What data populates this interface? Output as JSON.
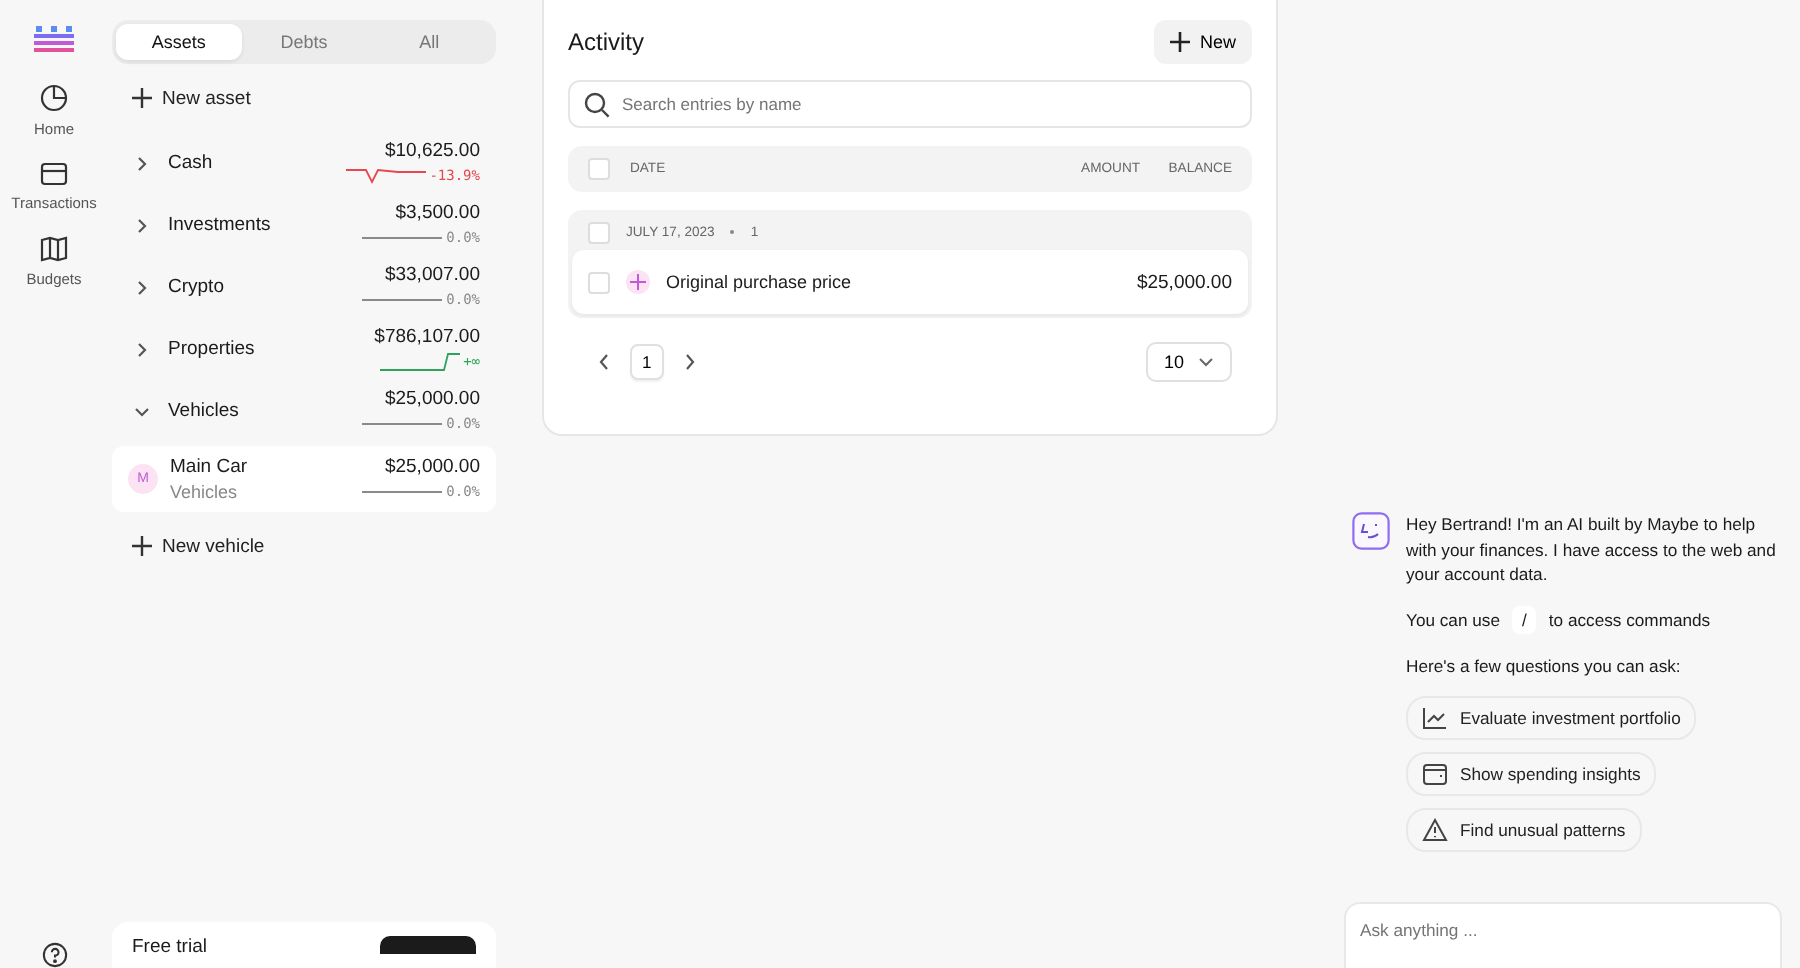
{
  "nav": [
    {
      "label": "Home"
    },
    {
      "label": "Transactions"
    },
    {
      "label": "Budgets"
    }
  ],
  "account_tabs": [
    {
      "label": "Assets",
      "selected": true
    },
    {
      "label": "Debts",
      "selected": false
    },
    {
      "label": "All",
      "selected": false
    }
  ],
  "new_asset": "New asset",
  "groups": [
    {
      "name": "Cash",
      "expanded": false,
      "balance": "$10,625.00",
      "change": "-13.9%",
      "kind": "down"
    },
    {
      "name": "Investments",
      "expanded": false,
      "balance": "$3,500.00",
      "change": "0.0%",
      "kind": "flat"
    },
    {
      "name": "Crypto",
      "expanded": false,
      "balance": "$33,007.00",
      "change": "0.0%",
      "kind": "flat"
    },
    {
      "name": "Properties",
      "expanded": false,
      "balance": "$786,107.00",
      "change": "+∞",
      "kind": "up"
    },
    {
      "name": "Vehicles",
      "expanded": true,
      "balance": "$25,000.00",
      "change": "0.0%",
      "kind": "flat",
      "accounts": [
        {
          "initial": "M",
          "name": "Main Car",
          "subtitle": "Vehicles",
          "balance": "$25,000.00",
          "change": "0.0%",
          "kind": "flat",
          "selected": true
        }
      ]
    }
  ],
  "new_vehicle": "New vehicle",
  "free_trial": {
    "title": "Free trial"
  },
  "activity": {
    "title": "Activity",
    "new_button": "New",
    "search": {
      "placeholder": "Search entries by name"
    },
    "columns": [
      "DATE",
      "AMOUNT",
      "BALANCE"
    ],
    "select_all_checked": false,
    "date_groups": [
      {
        "date": "JULY 17, 2023",
        "count": "1",
        "checked": false,
        "entries": [
          {
            "name": "Original purchase price",
            "amount": "$25,000.00",
            "checked": false
          }
        ]
      }
    ],
    "pages": [
      {
        "label": "1",
        "selected": true
      }
    ],
    "per_page": "10"
  },
  "chat": {
    "intro": "Hey Bertrand! I'm an AI built by Maybe to help with your finances. I have access to the web and your account data.",
    "commands_before": "You can use",
    "command_key": "/",
    "commands_after": "to access commands",
    "questions_heading": "Here's a few questions you can ask:",
    "suggestions": [
      {
        "label": "Evaluate investment portfolio"
      },
      {
        "label": "Show spending insights"
      },
      {
        "label": "Find unusual patterns"
      }
    ],
    "input": {
      "placeholder": "Ask anything ..."
    }
  }
}
